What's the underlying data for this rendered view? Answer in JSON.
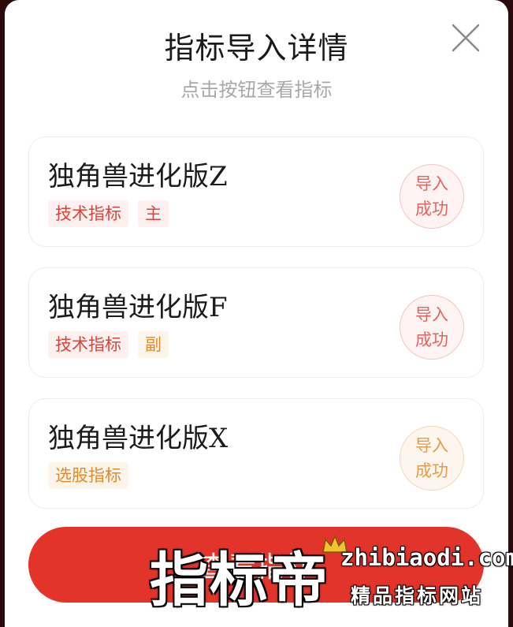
{
  "header": {
    "title": "指标导入详情",
    "subtitle": "点击按钮查看指标",
    "close_icon": "close-icon"
  },
  "cards": [
    {
      "name": "独角兽进化版Z",
      "tags": [
        {
          "label": "技术指标",
          "tone": "red"
        },
        {
          "label": "主",
          "tone": "red"
        }
      ],
      "status_line1": "导入",
      "status_line2": "成功",
      "status_tone": "red"
    },
    {
      "name": "独角兽进化版F",
      "tags": [
        {
          "label": "技术指标",
          "tone": "red"
        },
        {
          "label": "副",
          "tone": "orange"
        }
      ],
      "status_line1": "导入",
      "status_line2": "成功",
      "status_tone": "red"
    },
    {
      "name": "独角兽进化版X",
      "tags": [
        {
          "label": "选股指标",
          "tone": "orange"
        }
      ],
      "status_line1": "导入",
      "status_line2": "成功",
      "status_tone": "orange"
    }
  ],
  "footer": {
    "button_label": "查看指标"
  },
  "watermark": {
    "brand": "指标帝",
    "url": "zhibiaodi.com",
    "slogan": "精品指标网站"
  },
  "colors": {
    "accent_red": "#e3342b",
    "tag_red": "#d8453b",
    "tag_orange": "#e38a2c"
  }
}
